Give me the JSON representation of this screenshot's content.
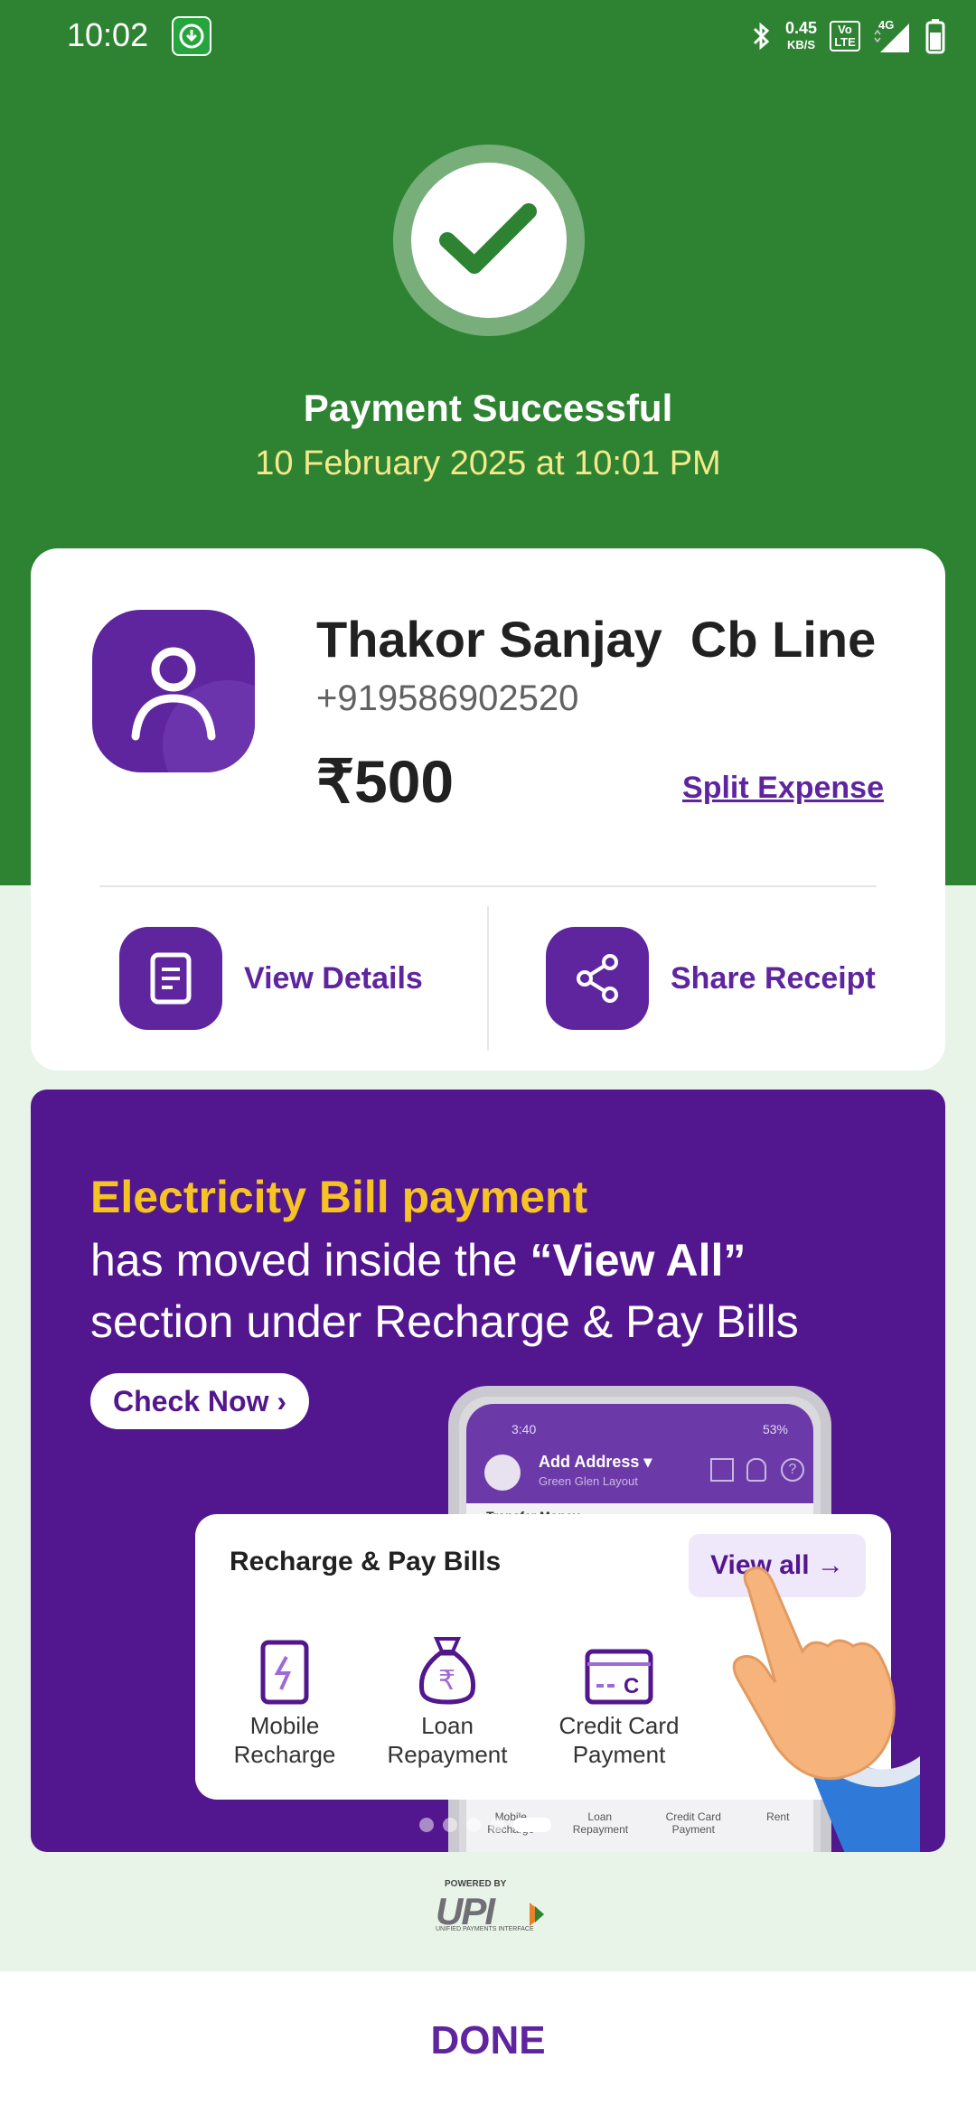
{
  "status_bar": {
    "time": "10:02",
    "net_speed": "0.45",
    "net_unit": "KB/S",
    "volte_top": "Vo",
    "volte_bottom": "LTE",
    "network": "4G"
  },
  "header": {
    "title": "Payment Successful",
    "datetime": "10 February 2025 at 10:01 PM"
  },
  "payee": {
    "name": "Thakor Sanjay  Cb Line",
    "phone": "+919586902520",
    "amount": "₹500",
    "split_label": "Split Expense"
  },
  "actions": {
    "view_details": "View Details",
    "share_receipt": "Share Receipt"
  },
  "banner": {
    "line1": "Electricity Bill payment",
    "line2_pre": "has moved inside the ",
    "line2_bold": "“View All”",
    "line3": "section under Recharge & Pay Bills",
    "cta": "Check Now ›",
    "phone_mock": {
      "time": "3:40",
      "battery": "53%",
      "address_title": "Add Address ▾",
      "address_sub": "Green Glen Layout",
      "section": "Transfer Money",
      "bottom_items": [
        "Mobile Recharge",
        "Loan Repayment",
        "Credit Card Payment",
        "Rent"
      ]
    },
    "card": {
      "title": "Recharge & Pay Bills",
      "view_all": "View all →",
      "items": [
        {
          "line1": "Mobile",
          "line2": "Recharge",
          "icon": "mobile-recharge-icon"
        },
        {
          "line1": "Loan",
          "line2": "Repayment",
          "icon": "loan-icon"
        },
        {
          "line1": "Credit Card",
          "line2": "Payment",
          "icon": "credit-card-icon"
        }
      ]
    },
    "carousel": {
      "count": 5,
      "active_index": 4
    }
  },
  "footer": {
    "powered_by": "POWERED BY",
    "upi": "UPI",
    "upi_sub": "UNIFIED PAYMENTS INTERFACE",
    "done": "DONE"
  },
  "colors": {
    "green": "#2e8333",
    "purple": "#5f259f",
    "banner": "#52168f",
    "yellow": "#f5c323",
    "date": "#f5e98a"
  }
}
